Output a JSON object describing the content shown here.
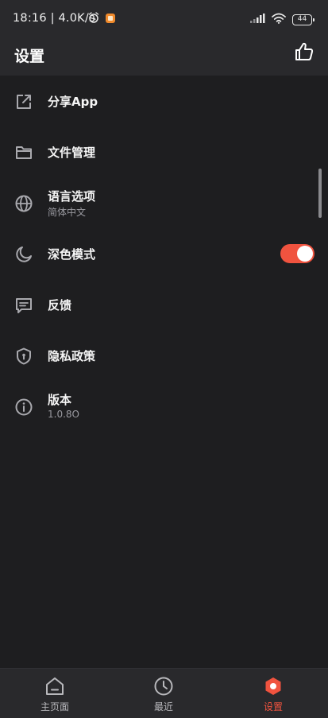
{
  "status_bar": {
    "time_speed": "18:16 | 4.0K/s",
    "battery_level": "44"
  },
  "header": {
    "title": "设置",
    "like_icon": "thumbs-up-icon"
  },
  "settings": {
    "items": [
      {
        "title": "分享App",
        "icon": "share-external-icon"
      },
      {
        "title": "文件管理",
        "icon": "folder-icon"
      },
      {
        "title": "语言选项",
        "subtitle": "简体中文",
        "icon": "globe-icon"
      },
      {
        "title": "深色模式",
        "icon": "moon-icon",
        "toggle_on": true
      },
      {
        "title": "反馈",
        "icon": "feedback-icon"
      },
      {
        "title": "隐私政策",
        "icon": "privacy-shield-icon"
      },
      {
        "title": "版本",
        "subtitle": "1.0.8O",
        "icon": "info-icon"
      }
    ]
  },
  "bottom_nav": {
    "items": [
      {
        "label": "主页面",
        "icon": "home-icon",
        "active": false
      },
      {
        "label": "最近",
        "icon": "clock-icon",
        "active": false
      },
      {
        "label": "设置",
        "icon": "settings-hex-icon",
        "active": true
      }
    ]
  },
  "colors": {
    "accent": "#f0533f",
    "background": "#1e1e20",
    "bar": "#29292c"
  }
}
